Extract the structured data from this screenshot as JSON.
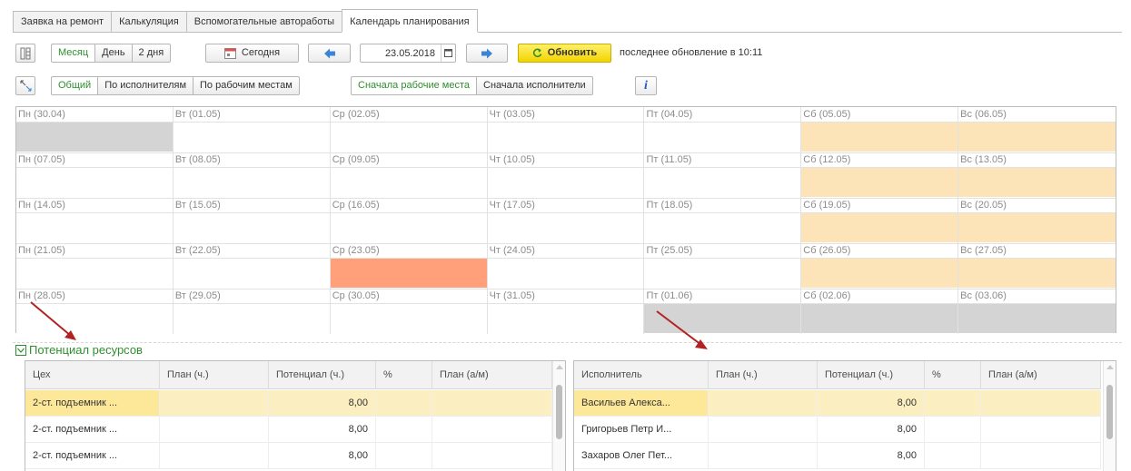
{
  "tabs": [
    {
      "label": "Заявка на ремонт"
    },
    {
      "label": "Калькуляция"
    },
    {
      "label": "Вспомогательные автоработы"
    },
    {
      "label": "Календарь планирования"
    }
  ],
  "toolbar1": {
    "periods": [
      "Месяц",
      "День",
      "2 дня"
    ],
    "today_label": "Сегодня",
    "date_value": "23.05.2018",
    "refresh_label": "Обновить",
    "last_update": "последнее обновление в 10:11"
  },
  "toolbar2": {
    "modes": [
      "Общий",
      "По исполнителям",
      "По рабочим местам"
    ],
    "orders": [
      "Сначала рабочие места",
      "Сначала исполнители"
    ],
    "info_label": "i"
  },
  "calendar": {
    "weeks": [
      [
        "Пн (30.04)",
        "Вт (01.05)",
        "Ср (02.05)",
        "Чт (03.05)",
        "Пт (04.05)",
        "Сб (05.05)",
        "Вс (06.05)"
      ],
      [
        "Пн (07.05)",
        "Вт (08.05)",
        "Ср (09.05)",
        "Чт (10.05)",
        "Пт (11.05)",
        "Сб (12.05)",
        "Вс (13.05)"
      ],
      [
        "Пн (14.05)",
        "Вт (15.05)",
        "Ср (16.05)",
        "Чт (17.05)",
        "Пт (18.05)",
        "Сб (19.05)",
        "Вс (20.05)"
      ],
      [
        "Пн (21.05)",
        "Вт (22.05)",
        "Ср (23.05)",
        "Чт (24.05)",
        "Пт (25.05)",
        "Сб (26.05)",
        "Вс (27.05)"
      ],
      [
        "Пн (28.05)",
        "Вт (29.05)",
        "Ср (30.05)",
        "Чт (31.05)",
        "Пт (01.06)",
        "Сб (02.06)",
        "Вс (03.06)"
      ]
    ],
    "colors": {
      "out_of_month": "#d4d4d4",
      "weekend": "#fde4b8",
      "today": "#ffa07a",
      "normal": "#ffffff"
    }
  },
  "resources": {
    "title": "Потенциал ресурсов",
    "left_table": {
      "headers": [
        "Цех",
        "План (ч.)",
        "Потенциал (ч.)",
        "%",
        "План (а/м)"
      ],
      "rows": [
        [
          "2-ст. подъемник ...",
          "",
          "8,00",
          "",
          ""
        ],
        [
          "2-ст. подъемник ...",
          "",
          "8,00",
          "",
          ""
        ],
        [
          "2-ст. подъемник ...",
          "",
          "8,00",
          "",
          ""
        ]
      ]
    },
    "right_table": {
      "headers": [
        "Исполнитель",
        "План (ч.)",
        "Потенциал (ч.)",
        "%",
        "План (а/м)"
      ],
      "rows": [
        [
          "Васильев Алекса...",
          "",
          "8,00",
          "",
          ""
        ],
        [
          "Григорьев Петр И...",
          "",
          "8,00",
          "",
          ""
        ],
        [
          "Захаров Олег Пет...",
          "",
          "8,00",
          "",
          ""
        ]
      ]
    }
  }
}
